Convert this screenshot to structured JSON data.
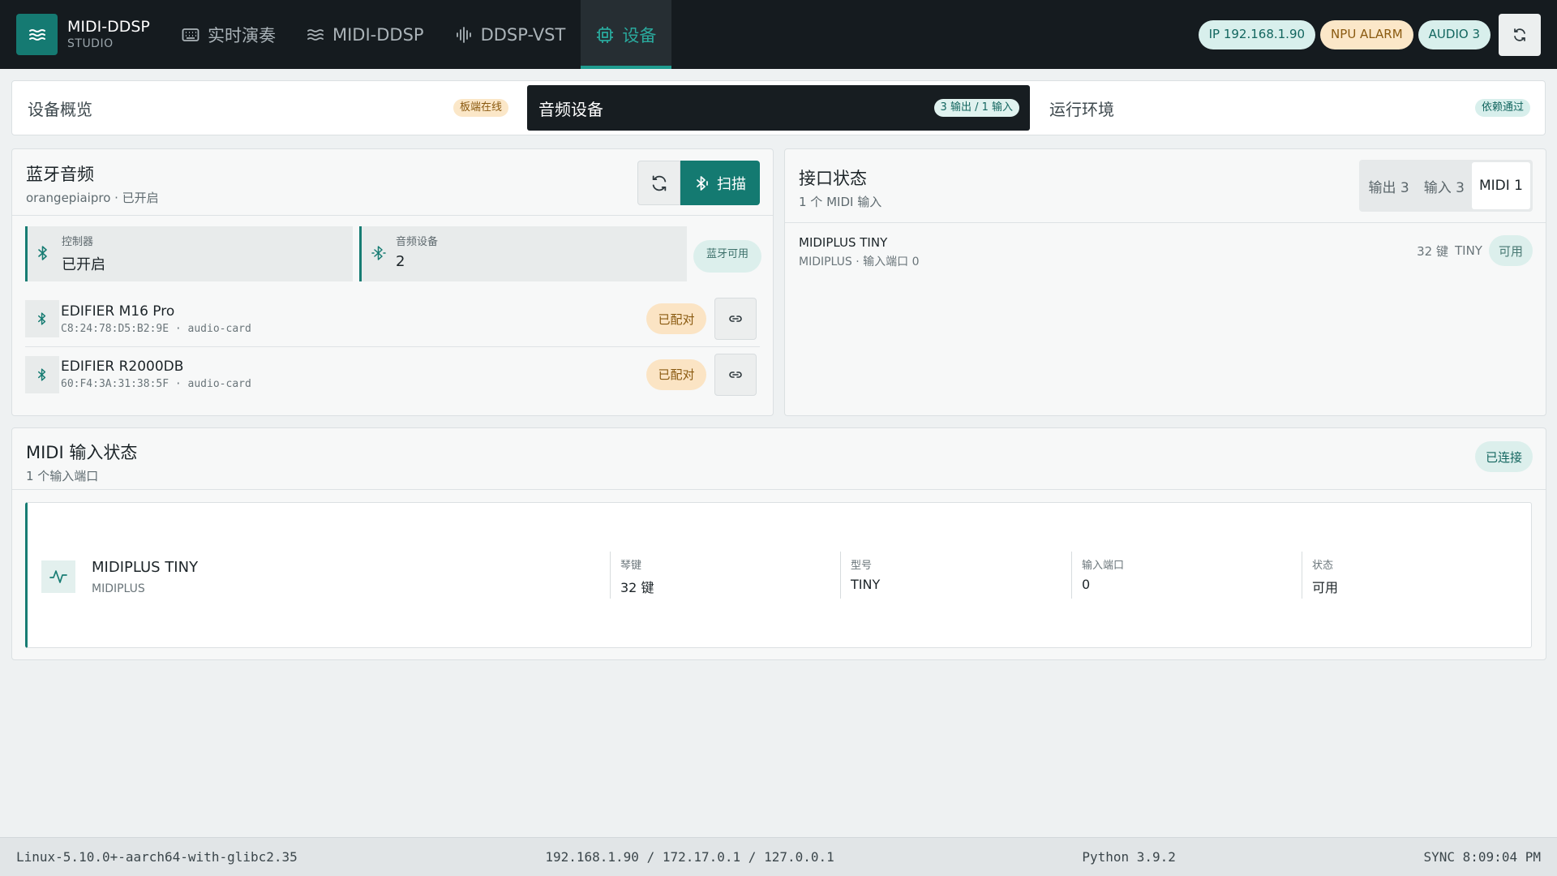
{
  "header": {
    "brand_title": "MIDI-DDSP",
    "brand_sub": "STUDIO",
    "nav": [
      {
        "label": "实时演奏",
        "icon": "keyboard-icon"
      },
      {
        "label": "MIDI-DDSP",
        "icon": "waves-icon"
      },
      {
        "label": "DDSP-VST",
        "icon": "waveform-icon"
      },
      {
        "label": "设备",
        "icon": "chip-icon",
        "active": true
      }
    ],
    "pills": {
      "ip": "IP 192.168.1.90",
      "npu": "NPU ALARM",
      "audio": "AUDIO 3"
    }
  },
  "tabs": [
    {
      "label": "设备概览",
      "badge": "板端在线"
    },
    {
      "label": "音频设备",
      "badge": "3 输出 / 1 输入",
      "active": true
    },
    {
      "label": "运行环境",
      "badge": "依赖通过"
    }
  ],
  "bluetooth": {
    "title": "蓝牙音频",
    "subtitle": "orangepiaipro · 已开启",
    "scan_label": "扫描",
    "stats": [
      {
        "label": "控制器",
        "value": "已开启"
      },
      {
        "label": "音频设备",
        "value": "2"
      }
    ],
    "availability": "蓝牙可用",
    "devices": [
      {
        "name": "EDIFIER M16 Pro",
        "meta": "C8:24:78:D5:B2:9E · audio-card",
        "status": "已配对"
      },
      {
        "name": "EDIFIER R2000DB",
        "meta": "60:F4:3A:31:38:5F · audio-card",
        "status": "已配对"
      }
    ]
  },
  "interfaces": {
    "title": "接口状态",
    "subtitle": "1 个 MIDI 输入",
    "segments": [
      {
        "label": "输出 3"
      },
      {
        "label": "输入 3"
      },
      {
        "label": "MIDI 1",
        "active": true
      }
    ],
    "row": {
      "name": "MIDIPLUS TINY",
      "meta": "MIDIPLUS · 输入端口 0",
      "keys": "32 键",
      "model": "TINY",
      "status": "可用"
    }
  },
  "midi_input": {
    "title": "MIDI 输入状态",
    "subtitle": "1 个输入端口",
    "connection": "已连接",
    "device": {
      "name": "MIDIPLUS TINY",
      "brand": "MIDIPLUS"
    },
    "fields": [
      {
        "label": "琴键",
        "value": "32 键"
      },
      {
        "label": "型号",
        "value": "TINY"
      },
      {
        "label": "输入端口",
        "value": "0"
      },
      {
        "label": "状态",
        "value": "可用"
      }
    ]
  },
  "footer": {
    "platform": "Linux-5.10.0+-aarch64-with-glibc2.35",
    "ips": "192.168.1.90 / 172.17.0.1 / 127.0.0.1",
    "python": "Python 3.9.2",
    "sync": "SYNC 8:09:04 PM"
  },
  "colors": {
    "accent": "#157a72",
    "topbar": "#151b1f",
    "warning": "#fbe7c8"
  }
}
